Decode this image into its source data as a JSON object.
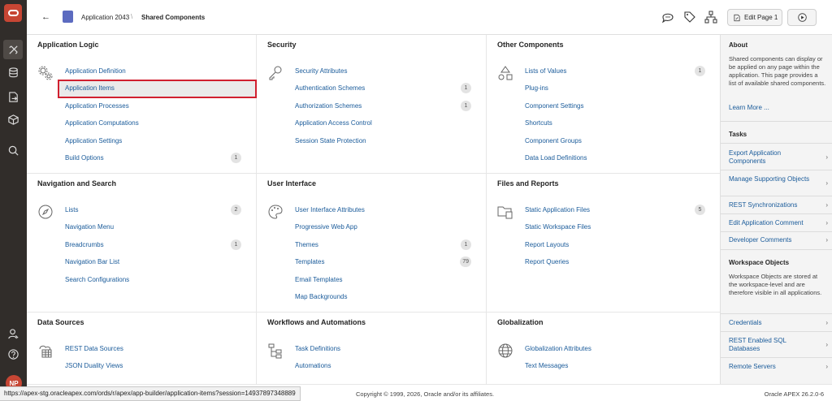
{
  "header": {
    "app_name": "Application 2043",
    "separator": "\\",
    "current_page": "Shared Components",
    "edit_button": "Edit Page 1"
  },
  "sections": {
    "app_logic": {
      "title": "Application Logic",
      "items": [
        {
          "label": "Application Definition",
          "count": ""
        },
        {
          "label": "Application Items",
          "count": ""
        },
        {
          "label": "Application Processes",
          "count": ""
        },
        {
          "label": "Application Computations",
          "count": ""
        },
        {
          "label": "Application Settings",
          "count": ""
        },
        {
          "label": "Build Options",
          "count": "1"
        }
      ]
    },
    "security": {
      "title": "Security",
      "items": [
        {
          "label": "Security Attributes",
          "count": ""
        },
        {
          "label": "Authentication Schemes",
          "count": "1"
        },
        {
          "label": "Authorization Schemes",
          "count": "1"
        },
        {
          "label": "Application Access Control",
          "count": ""
        },
        {
          "label": "Session State Protection",
          "count": ""
        }
      ]
    },
    "other": {
      "title": "Other Components",
      "items": [
        {
          "label": "Lists of Values",
          "count": "1"
        },
        {
          "label": "Plug-ins",
          "count": ""
        },
        {
          "label": "Component Settings",
          "count": ""
        },
        {
          "label": "Shortcuts",
          "count": ""
        },
        {
          "label": "Component Groups",
          "count": ""
        },
        {
          "label": "Data Load Definitions",
          "count": ""
        }
      ]
    },
    "navigation": {
      "title": "Navigation and Search",
      "items": [
        {
          "label": "Lists",
          "count": "2"
        },
        {
          "label": "Navigation Menu",
          "count": ""
        },
        {
          "label": "Breadcrumbs",
          "count": "1"
        },
        {
          "label": "Navigation Bar List",
          "count": ""
        },
        {
          "label": "Search Configurations",
          "count": ""
        }
      ]
    },
    "ui": {
      "title": "User Interface",
      "items": [
        {
          "label": "User Interface Attributes",
          "count": ""
        },
        {
          "label": "Progressive Web App",
          "count": ""
        },
        {
          "label": "Themes",
          "count": "1"
        },
        {
          "label": "Templates",
          "count": "79"
        },
        {
          "label": "Email Templates",
          "count": ""
        },
        {
          "label": "Map Backgrounds",
          "count": ""
        }
      ]
    },
    "files": {
      "title": "Files and Reports",
      "items": [
        {
          "label": "Static Application Files",
          "count": "5"
        },
        {
          "label": "Static Workspace Files",
          "count": ""
        },
        {
          "label": "Report Layouts",
          "count": ""
        },
        {
          "label": "Report Queries",
          "count": ""
        }
      ]
    },
    "data_sources": {
      "title": "Data Sources",
      "items": [
        {
          "label": "REST Data Sources",
          "count": ""
        },
        {
          "label": "JSON Duality Views",
          "count": ""
        }
      ]
    },
    "workflows": {
      "title": "Workflows and Automations",
      "items": [
        {
          "label": "Task Definitions",
          "count": ""
        },
        {
          "label": "Automations",
          "count": ""
        }
      ]
    },
    "globalization": {
      "title": "Globalization",
      "items": [
        {
          "label": "Globalization Attributes",
          "count": ""
        },
        {
          "label": "Text Messages",
          "count": ""
        }
      ]
    }
  },
  "sidebar": {
    "about_title": "About",
    "about_text": "Shared components can display or be applied on any page within the application. This page provides a list of available shared components.",
    "learn_more": "Learn More ...",
    "tasks_title": "Tasks",
    "tasks": [
      "Export Application Components",
      "Manage Supporting Objects",
      "REST Synchronizations",
      "Edit Application Comment",
      "Developer Comments"
    ],
    "workspace_title": "Workspace Objects",
    "workspace_text": "Workspace Objects are stored at the workspace-level and are therefore visible in all applications.",
    "workspace_links": [
      "Credentials",
      "REST Enabled SQL Databases",
      "Remote Servers"
    ]
  },
  "user": {
    "initials": "NP"
  },
  "footer": {
    "url": "https://apex-stg.oracleapex.com/ords/r/apex/app-builder/application-items?session=14937897348889",
    "copyright": "Copyright © 1999, 2026, Oracle and/or its affiliates.",
    "version": "Oracle APEX 26.2.0-6"
  },
  "colors": {
    "accent_red": "#c74634",
    "link": "#1a5b9a",
    "highlight_border": "#d1202f",
    "nav_bg": "#312d2a"
  }
}
